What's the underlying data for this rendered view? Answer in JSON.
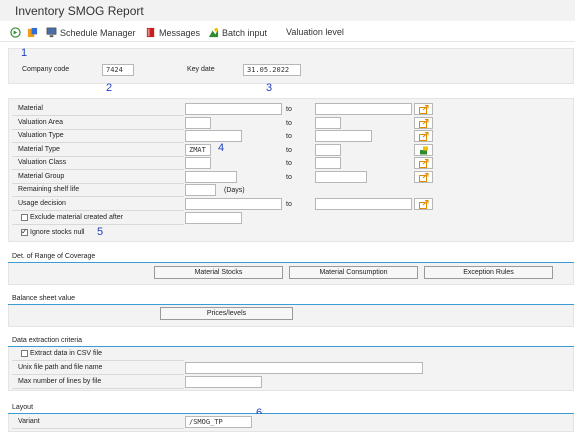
{
  "window": {
    "title": "Inventory SMOG Report"
  },
  "toolbar": {
    "execute_icon": "execute-icon",
    "variant_icon": "get-variant-icon",
    "schedule_label": "Schedule Manager",
    "messages_label": "Messages",
    "batch_label": "Batch input",
    "valuation_label": "Valuation level"
  },
  "markers": [
    "1",
    "2",
    "3",
    "4",
    "5",
    "6"
  ],
  "header_block": {
    "company_code_label": "Company code",
    "company_code_value": "7424",
    "key_date_label": "Key date",
    "key_date_value": "31.05.2022"
  },
  "selection": {
    "to_label": "to",
    "rows": [
      {
        "label": "Material",
        "value": ""
      },
      {
        "label": "Valuation Area",
        "value": ""
      },
      {
        "label": "Valuation Type",
        "value": ""
      },
      {
        "label": "Material Type",
        "value": "ZMAT"
      },
      {
        "label": "Valuation Class",
        "value": ""
      },
      {
        "label": "Material Group",
        "value": ""
      }
    ],
    "shelf_life_label": "Remaining shelf life",
    "shelf_life_value": "",
    "days_label": "(Days)",
    "usage_label": "Usage decision",
    "exclude_label": "Exclude material created after",
    "exclude_checked": false,
    "ignore_label": "Ignore stocks null",
    "ignore_checked": true
  },
  "coverage": {
    "title": "Det. of Range of Coverage",
    "btn_stocks": "Material Stocks",
    "btn_consumption": "Material Consumption",
    "btn_exceptions": "Exception Rules"
  },
  "balance": {
    "title": "Balance sheet value",
    "btn_prices": "Prices/levels"
  },
  "extraction": {
    "title": "Data extraction criteria",
    "csv_label": "Extract data in CSV file",
    "csv_checked": false,
    "path_label": "Unix file path and file name",
    "path_value": "",
    "maxlines_label": "Max number of lines by file",
    "maxlines_value": ""
  },
  "layout": {
    "title": "Layout",
    "variant_label": "Variant",
    "variant_value": "/SMOG_TP"
  },
  "colors": {
    "accent_line": "#3b9bd3",
    "marker": "#1f3fbf",
    "panel": "#f3f3f3"
  }
}
